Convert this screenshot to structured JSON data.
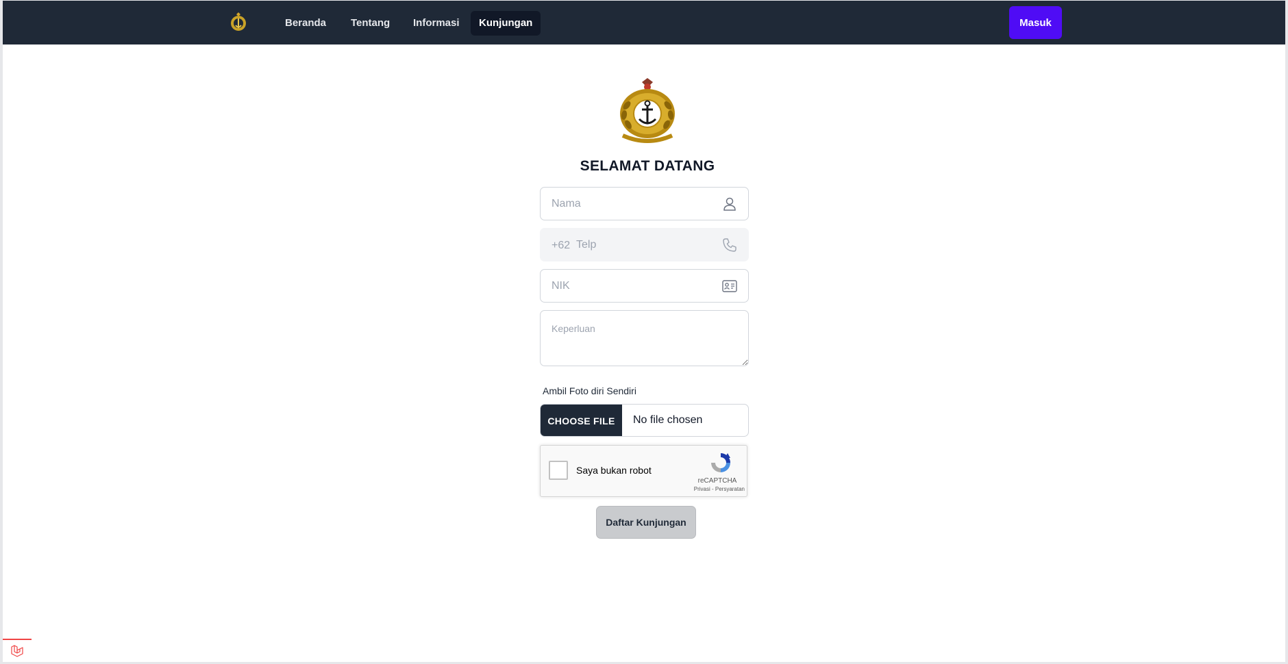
{
  "nav": {
    "links": [
      {
        "label": "Beranda"
      },
      {
        "label": "Tentang"
      },
      {
        "label": "Informasi"
      },
      {
        "label": "Kunjungan",
        "active": true
      }
    ],
    "login_label": "Masuk"
  },
  "main": {
    "title": "SELAMAT DATANG",
    "fields": {
      "name_placeholder": "Nama",
      "phone_prefix": "+62",
      "phone_placeholder": "Telp",
      "nik_placeholder": "NIK",
      "purpose_placeholder": "Keperluan"
    },
    "photo": {
      "label": "Ambil Foto diri Sendiri",
      "button_label": "CHOOSE FILE",
      "status": "No file chosen"
    },
    "recaptcha": {
      "label": "Saya bukan robot",
      "brand": "reCAPTCHA",
      "links": "Privasi - Persyaratan"
    },
    "submit_label": "Daftar Kunjungan"
  },
  "colors": {
    "navbar": "#1f2937",
    "login_button": "#4f0cf5",
    "file_button": "#1f2937",
    "submit_button": "#c9cbce"
  },
  "icons": {
    "nav_logo": "navy-emblem-icon",
    "emblem": "navy-anchor-emblem",
    "name_field": "user-icon",
    "phone_field": "phone-icon",
    "nik_field": "id-card-icon",
    "corner": "laravel-icon"
  }
}
